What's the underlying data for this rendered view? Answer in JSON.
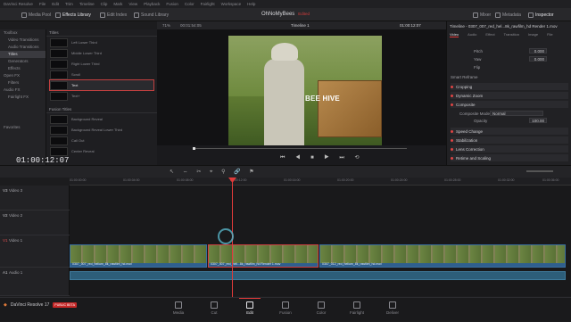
{
  "menubar": {
    "items": [
      "DaVinci Resolve",
      "File",
      "Edit",
      "Trim",
      "Timeline",
      "Clip",
      "Mark",
      "View",
      "Playback",
      "Fusion",
      "Color",
      "Fairlight",
      "Workspace",
      "Help"
    ]
  },
  "toolbar": {
    "media_pool": "Media Pool",
    "effects_library": "Effects Library",
    "edit_index": "Edit Index",
    "sound_library": "Sound Library",
    "project_title": "OhNoMyBees",
    "edited_label": "Edited",
    "mixer": "Mixer",
    "metadata": "Metadata",
    "inspector": "Inspector"
  },
  "viewer": {
    "zoom": "71%",
    "source_tc": "00:01:54:05",
    "timeline_name": "Timeline 1",
    "record_tc": "01:00:12:07",
    "overlay_text": "BEE HIVE"
  },
  "sidebar": {
    "items": [
      {
        "label": "Toolbox"
      },
      {
        "label": "Video Transitions"
      },
      {
        "label": "Audio Transitions"
      },
      {
        "label": "Titles"
      },
      {
        "label": "Generators"
      },
      {
        "label": "Effects"
      },
      {
        "label": "Open FX"
      },
      {
        "label": "Filters"
      },
      {
        "label": "Audio FX"
      },
      {
        "label": "Fairlight FX"
      }
    ],
    "favorites": "Favorites"
  },
  "titles_panel": {
    "section": "Titles",
    "items": [
      "Left Lower Third",
      "Middle Lower Third",
      "Right Lower Third",
      "Scroll",
      "Text",
      "Text+"
    ],
    "fusion_section": "Fusion Titles",
    "fusion_items": [
      "Background Reveal",
      "Background Reveal Lower Third",
      "Call Out",
      "Center Reveal"
    ]
  },
  "inspector": {
    "clip_name": "Timeline - 0307_007_red_hel...8k_rawfilm_hd Render 1.mov",
    "tabs": [
      "Video",
      "Audio",
      "Effect",
      "Transition",
      "Image",
      "File"
    ],
    "pitch_label": "Pitch",
    "pitch_value": "0.000",
    "yaw_label": "Yaw",
    "yaw_value": "0.000",
    "flip_label": "Flip",
    "sections": [
      "Smart Reframe",
      "Cropping",
      "Dynamic Zoom",
      "Composite",
      "Speed Change",
      "Stabilization",
      "Lens Correction",
      "Retime and Scaling"
    ],
    "composite_mode_label": "Composite Mode",
    "composite_mode_value": "Normal",
    "opacity_label": "Opacity",
    "opacity_value": "100.00"
  },
  "timeline": {
    "timecode": "01:00:12:07",
    "ruler": [
      "01:00:00:00",
      "01:00:04:00",
      "01:00:08:00",
      "01:00:12:00",
      "01:00:16:00",
      "01:00:20:00",
      "01:00:24:00",
      "01:00:28:00",
      "01:00:32:00",
      "01:00:36:00"
    ],
    "tracks": [
      {
        "id": "V3",
        "name": "Video 3",
        "count": "0 Clip"
      },
      {
        "id": "V2",
        "name": "Video 2",
        "count": "0 Clip"
      },
      {
        "id": "V1",
        "name": "Video 1",
        "count": "3 Clips"
      },
      {
        "id": "A1",
        "name": "Audio 1",
        "level": "2.0"
      }
    ],
    "clips": [
      "0307_007_red_helium_8k_rawfilm_hd.mov",
      "0307_007_red_heli...8k_rawfilm_hd Render 1.mov",
      "0307_012_red_helium_8k_rawfilm_hd.mov"
    ]
  },
  "bottom": {
    "app_name": "DaVinci Resolve 17",
    "badge": "PUBLIC BETA",
    "pages": [
      "Media",
      "Cut",
      "Edit",
      "Fusion",
      "Color",
      "Fairlight",
      "Deliver"
    ]
  }
}
